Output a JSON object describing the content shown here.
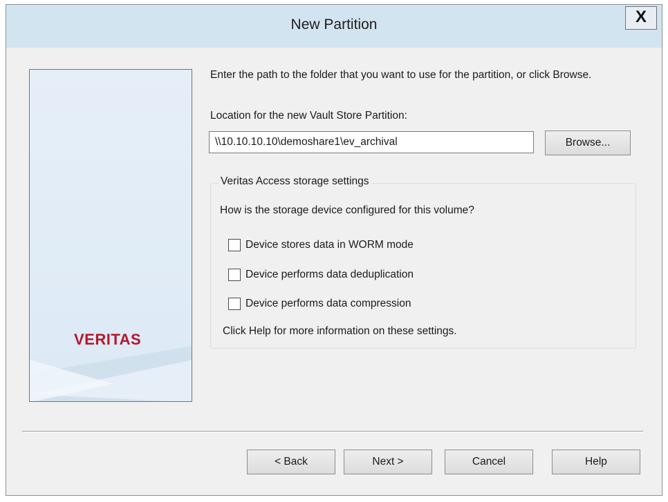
{
  "window": {
    "title": "New Partition",
    "close_label": "X"
  },
  "side_panel": {
    "logo_text": "VERITAS",
    "logo_color": "#b5172c"
  },
  "content": {
    "intro_text": "Enter the path to the folder that you want to use for the partition, or click Browse.",
    "location_label": "Location for the new Vault Store Partition:",
    "location_value": "\\\\10.10.10.10\\demoshare1\\ev_archival",
    "browse_label": "Browse..."
  },
  "storage_settings": {
    "group_title": "Veritas Access storage settings",
    "question": "How is the storage device configured for this volume?",
    "options": [
      {
        "label": "Device stores data in WORM mode",
        "checked": false
      },
      {
        "label": "Device performs data deduplication",
        "checked": false
      },
      {
        "label": "Device performs data compression",
        "checked": false
      }
    ],
    "help_note": "Click Help for more information on these settings."
  },
  "buttons": {
    "back": "< Back",
    "next": "Next >",
    "cancel": "Cancel",
    "help": "Help"
  }
}
